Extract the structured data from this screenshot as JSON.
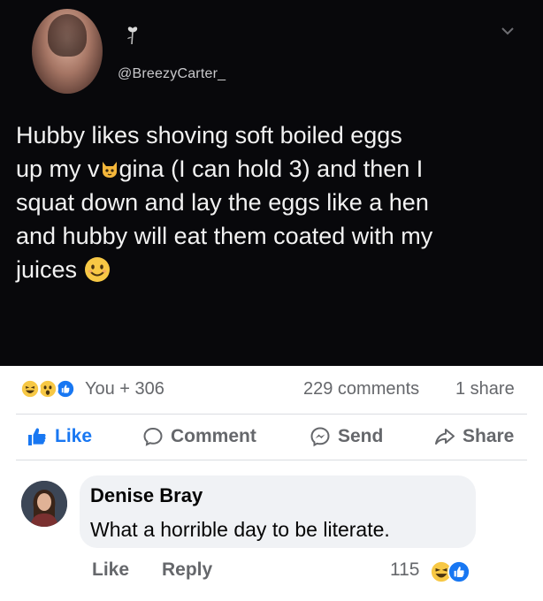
{
  "tweet": {
    "handle": "@BreezyCarter_",
    "lines": [
      "Hubby likes shoving soft boiled eggs",
      [
        "up my v",
        "gina (I can hold 3) and then I"
      ],
      "squat down and lay the eggs like a hen",
      "and hubby will eat them coated with my",
      "juices"
    ],
    "emoji_names": [
      "rose-icon",
      "cat-face-emoji",
      "smiling-face-emoji"
    ]
  },
  "post": {
    "reaction_summary": "You + 306",
    "comments": "229 comments",
    "shares": "1 share",
    "reaction_types": [
      "haha",
      "wow",
      "like"
    ]
  },
  "actions": {
    "like": "Like",
    "comment": "Comment",
    "send": "Send",
    "share": "Share"
  },
  "comment": {
    "author": "Denise Bray",
    "text": "What a horrible day to be literate.",
    "like_label": "Like",
    "reply_label": "Reply",
    "reaction_count": "115",
    "reaction_types": [
      "haha",
      "like"
    ]
  },
  "colors": {
    "fb_blue": "#1877f2",
    "meta_gray": "#65676b",
    "tweet_bg": "#08080b",
    "bubble_bg": "#f0f2f5"
  }
}
